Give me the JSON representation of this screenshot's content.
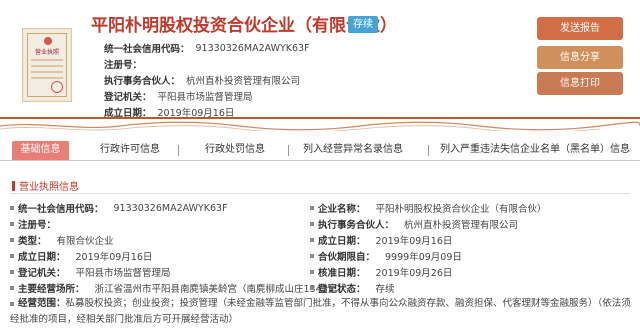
{
  "license_image": {
    "title": "营业执照"
  },
  "company": {
    "name": "平阳朴明股权投资合伙企业（有限合伙）",
    "status": "存续"
  },
  "summary": [
    {
      "label": "统一社会信用代码：",
      "value": "91330326MA2AWYK63F"
    },
    {
      "label": "注册号：",
      "value": ""
    },
    {
      "label": "执行事务合伙人：",
      "value": "杭州直朴投资管理有限公司"
    },
    {
      "label": "登记机关：",
      "value": "平阳县市场监督管理局"
    },
    {
      "label": "成立日期：",
      "value": "2019年09月16日"
    }
  ],
  "actions": {
    "report": "发送报告",
    "share": "信息分享",
    "print": "信息打印"
  },
  "tabs": [
    "基础信息",
    "行政许可信息",
    "行政处罚信息",
    "列入经营异常名录信息",
    "列入严重违法失信企业名单（黑名单）信息"
  ],
  "section": {
    "title": "营业执照信息"
  },
  "details_left": [
    {
      "label": "统一社会信用代码：",
      "value": "91330326MA2AWYK63F"
    },
    {
      "label": "注册号：",
      "value": ""
    },
    {
      "label": "类型：",
      "value": "有限合伙企业"
    },
    {
      "label": "成立日期：",
      "value": "2019年09月16日"
    },
    {
      "label": "登记机关：",
      "value": "平阳县市场监督管理局"
    },
    {
      "label": "主要经营场所：",
      "value": "浙江省温州市平阳县南麂镇美龄宫（南麂柳成山庄1343室）"
    }
  ],
  "details_right": [
    {
      "label": "企业名称：",
      "value": "平阳朴明股权投资合伙企业（有限合伙）"
    },
    {
      "label": "执行事务合伙人：",
      "value": "杭州直朴投资管理有限公司"
    },
    {
      "label": "成立日期：",
      "value": "2019年09月16日"
    },
    {
      "label": "合伙期限自：",
      "value": "9999年09月09日"
    },
    {
      "label": "核准日期：",
      "value": "2019年09月26日"
    },
    {
      "label": "登记状态：",
      "value": "存续"
    }
  ],
  "scope": {
    "label": "经营范围：",
    "value": "私募股权投资；创业投资；投资管理（未经金融等监管部门批准，不得从事向公众融资存款、融资担保、代客理财等金融服务）（依法须经批准的项目，经相关部门批准后方可开展经营活动）"
  },
  "colors": {
    "title": "#c0392b",
    "status_badge": "#46a3d6",
    "active_tab": "#e97e76",
    "button": "#d26e45"
  }
}
